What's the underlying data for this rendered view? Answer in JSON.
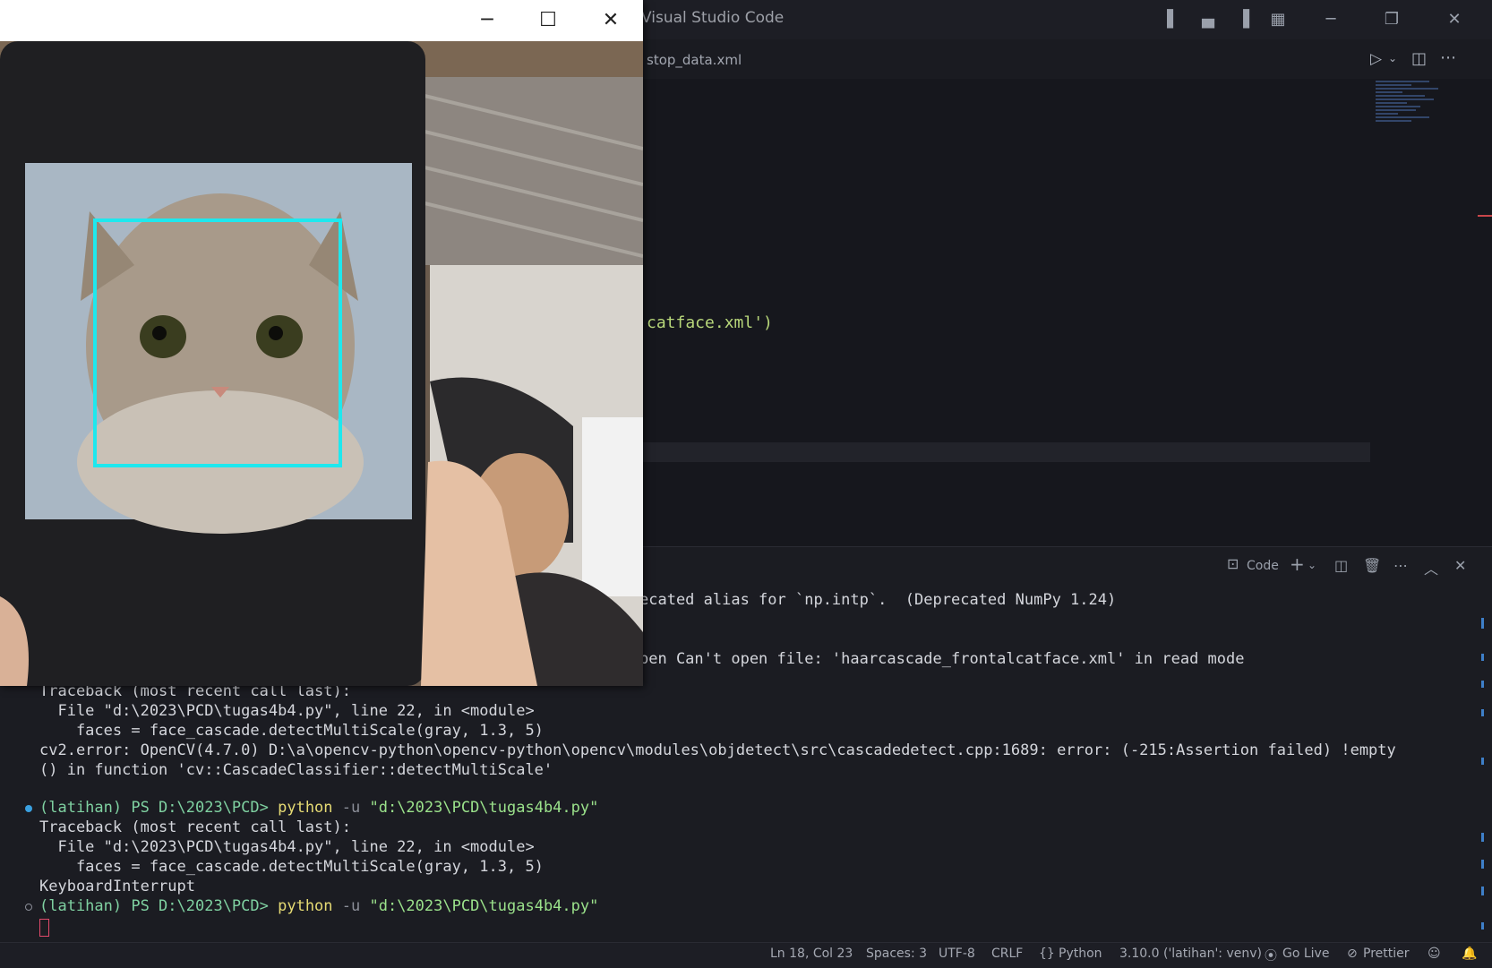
{
  "vscode": {
    "title": "Visual Studio Code",
    "tab": "stop_data.xml",
    "code_visible": [
      "catface.xml')"
    ]
  },
  "panel": {
    "profile_label": "Code",
    "terminal_lines": [
      "ecated alias for `np.intp`.  (Deprecated NumPy 1.24)",
      "pen Can't open file: 'haarcascade_frontalcatface.xml' in read mode",
      "Traceback (most recent call last):",
      "  File \"d:\\2023\\PCD\\tugas4b4.py\", line 22, in <module>",
      "    faces = face_cascade.detectMultiScale(gray, 1.3, 5)",
      "cv2.error: OpenCV(4.7.0) D:\\a\\opencv-python\\opencv-python\\opencv\\modules\\objdetect\\src\\cascadedetect.cpp:1689: error: (-215:Assertion failed) !empty",
      "() in function 'cv::CascadeClassifier::detectMultiScale'",
      "Traceback (most recent call last):",
      "  File \"d:\\2023\\PCD\\tugas4b4.py\", line 22, in <module>",
      "    faces = face_cascade.detectMultiScale(gray, 1.3, 5)",
      "KeyboardInterrupt"
    ],
    "prompt_prefix": "(latihan) PS D:\\2023\\PCD> ",
    "prompt_cmd": "python",
    "prompt_flag": " -u ",
    "prompt_arg": "\"d:\\2023\\PCD\\tugas4b4.py\""
  },
  "statusbar": {
    "position": "Ln 18, Col 23",
    "spaces": "Spaces: 3",
    "encoding": "UTF-8",
    "eol": "CRLF",
    "language": "Python",
    "interpreter": "3.10.0 ('latihan': venv)",
    "golive": "Go Live",
    "prettier": "Prettier"
  },
  "colors": {
    "detection_box": "#1ee8ee",
    "prompt_dot": "#3aa0e0"
  }
}
